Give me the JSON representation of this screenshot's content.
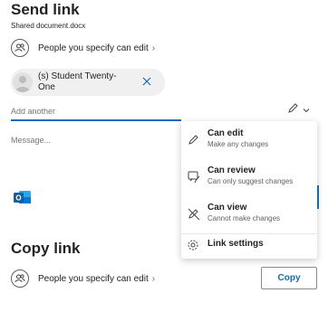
{
  "send_link": {
    "title": "Send link",
    "filename": "Shared document.docx",
    "permission_label": "People you specify can edit",
    "recipient_chip": {
      "name_line1": "(s) Student Twenty-",
      "name_line2": "One"
    },
    "add_another_placeholder": "Add another",
    "message_placeholder": "Message..."
  },
  "permission_menu": {
    "items": [
      {
        "title": "Can edit",
        "subtitle": "Make any changes",
        "icon": "pencil-icon"
      },
      {
        "title": "Can review",
        "subtitle": "Can only suggest changes",
        "icon": "review-icon"
      },
      {
        "title": "Can view",
        "subtitle": "Cannot make changes",
        "icon": "view-icon"
      },
      {
        "title": "Link settings",
        "subtitle": "",
        "icon": "gear-icon"
      }
    ]
  },
  "copy_link": {
    "title": "Copy link",
    "permission_label": "People you specify can edit",
    "copy_button": "Copy"
  },
  "colors": {
    "accent": "#0f6cbd",
    "outlook_blue": "#0f78d4"
  }
}
